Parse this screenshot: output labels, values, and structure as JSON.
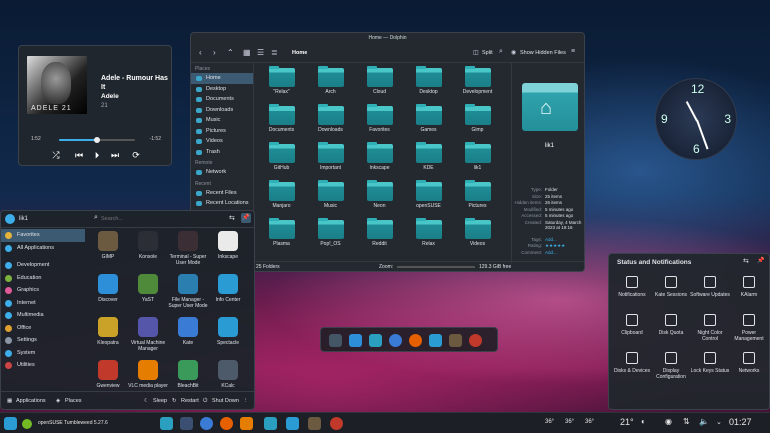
{
  "media": {
    "title": "Adele - Rumour Has It",
    "artist": "Adele",
    "album": "21",
    "album_text": "ADELE 21",
    "elapsed": "1:52",
    "remaining": "-1:52",
    "progress": 0.5
  },
  "dolphin": {
    "window_title": "Home — Dolphin",
    "breadcrumb": "Home",
    "split": "Split",
    "show_hidden": "Show Hidden Files",
    "places_header": "Places",
    "places": [
      "Home",
      "Desktop",
      "Documents",
      "Downloads",
      "Music",
      "Pictures",
      "Videos",
      "Trash"
    ],
    "remote_header": "Remote",
    "remote": [
      "Network"
    ],
    "recent_header": "Recent",
    "recent": [
      "Recent Files",
      "Recent Locations"
    ],
    "folders": [
      "\"Relax\"",
      "Arch",
      "Cloud",
      "Desktop",
      "Development",
      "Documents",
      "Downloads",
      "Favorites",
      "Games",
      "Gimp",
      "GitHub",
      "Important",
      "Inkscape",
      "KDE",
      "lik1",
      "Manjaro",
      "Music",
      "Neon",
      "openSUSE",
      "Pictures",
      "Plasma",
      "Pop!_OS",
      "Reddit",
      "Relax",
      "Videos"
    ],
    "info": {
      "name": "lik1",
      "rows": [
        [
          "Type:",
          "Folder"
        ],
        [
          "Size:",
          "25 items"
        ],
        [
          "Hidden items:",
          "26 items"
        ],
        [
          "Modified:",
          "5 minutes ago"
        ],
        [
          "Accessed:",
          "5 minutes ago"
        ],
        [
          "Created:",
          "Saturday, 4 March 2023 at 19:16"
        ],
        [
          "Tags:",
          "Add..."
        ],
        [
          "Rating:",
          "★★★★★"
        ],
        [
          "Comment:",
          "Add..."
        ]
      ]
    },
    "status_left": "25 Folders",
    "zoom": "Zoom:",
    "free": "129.3 GiB free"
  },
  "launcher": {
    "user": "lik1",
    "search_placeholder": "Search...",
    "categories": [
      "Favorites",
      "All Applications",
      "Development",
      "Education",
      "Graphics",
      "Internet",
      "Multimedia",
      "Office",
      "Settings",
      "System",
      "Utilities"
    ],
    "apps": [
      [
        "GIMP",
        "Konsole",
        "Terminal - Super User Mode",
        "Inkscape"
      ],
      [
        "Discover",
        "YaST",
        "File Manager - Super User Mode",
        "Info Center"
      ],
      [
        "Kleopatra",
        "Virtual Machine Manager",
        "Kate",
        "Spectacle"
      ],
      [
        "Gwenview",
        "VLC media player",
        "BleachBit",
        "KCalc"
      ]
    ],
    "footer": {
      "applications": "Applications",
      "places": "Places",
      "sleep": "Sleep",
      "restart": "Restart",
      "shutdown": "Shut Down"
    }
  },
  "status": {
    "title": "Status and Notifications",
    "items": [
      [
        "Notifications",
        "Kate Sessions",
        "Software Updates",
        "KAlarm"
      ],
      [
        "Clipboard",
        "Disk Quota",
        "Night Color Control",
        "Power Management"
      ],
      [
        "Disks & Devices",
        "Display Configuration",
        "Lock Keys Status",
        "Networks"
      ]
    ]
  },
  "taskbar": {
    "os": "openSUSE Tumbleweed 5.27.6",
    "temps": [
      "36°",
      "36°",
      "36°"
    ],
    "weather": "21°",
    "time": "01:27"
  },
  "clock": {
    "twelve": "12",
    "three": "3",
    "six": "6",
    "nine": "9"
  }
}
